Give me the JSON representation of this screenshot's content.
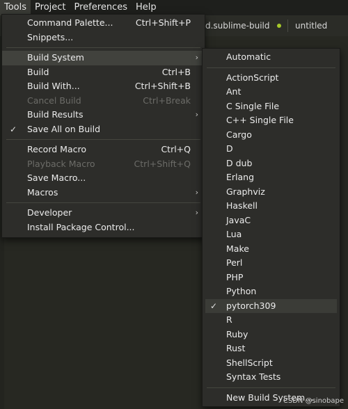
{
  "menubar": [
    "Tools",
    "Project",
    "Preferences",
    "Help"
  ],
  "tabs": {
    "file": "d.sublime-build",
    "untitled": "untitled"
  },
  "tools_menu": {
    "group1": [
      {
        "label": "Command Palette...",
        "shortcut": "Ctrl+Shift+P"
      },
      {
        "label": "Snippets...",
        "shortcut": ""
      }
    ],
    "group2": [
      {
        "label": "Build System",
        "shortcut": "",
        "submenu": true,
        "highlighted": true
      },
      {
        "label": "Build",
        "shortcut": "Ctrl+B"
      },
      {
        "label": "Build With...",
        "shortcut": "Ctrl+Shift+B"
      },
      {
        "label": "Cancel Build",
        "shortcut": "Ctrl+Break",
        "disabled": true
      },
      {
        "label": "Build Results",
        "shortcut": "",
        "submenu": true
      },
      {
        "label": "Save All on Build",
        "shortcut": "",
        "checked": true
      }
    ],
    "group3": [
      {
        "label": "Record Macro",
        "shortcut": "Ctrl+Q"
      },
      {
        "label": "Playback Macro",
        "shortcut": "Ctrl+Shift+Q",
        "disabled": true
      },
      {
        "label": "Save Macro...",
        "shortcut": ""
      },
      {
        "label": "Macros",
        "shortcut": "",
        "submenu": true
      }
    ],
    "group4": [
      {
        "label": "Developer",
        "shortcut": "",
        "submenu": true
      },
      {
        "label": "Install Package Control...",
        "shortcut": ""
      }
    ]
  },
  "build_system_menu": {
    "group1": [
      {
        "label": "Automatic"
      }
    ],
    "group2": [
      {
        "label": "ActionScript"
      },
      {
        "label": "Ant"
      },
      {
        "label": "C Single File"
      },
      {
        "label": "C++ Single File"
      },
      {
        "label": "Cargo"
      },
      {
        "label": "D"
      },
      {
        "label": "D dub"
      },
      {
        "label": "Erlang"
      },
      {
        "label": "Graphviz"
      },
      {
        "label": "Haskell"
      },
      {
        "label": "JavaC"
      },
      {
        "label": "Lua"
      },
      {
        "label": "Make"
      },
      {
        "label": "Perl"
      },
      {
        "label": "PHP"
      },
      {
        "label": "Python"
      },
      {
        "label": "pytorch309",
        "checked": true
      },
      {
        "label": "R"
      },
      {
        "label": "Ruby"
      },
      {
        "label": "Rust"
      },
      {
        "label": "ShellScript"
      },
      {
        "label": "Syntax Tests"
      }
    ],
    "group3": [
      {
        "label": "New Build System..."
      }
    ]
  },
  "symbols": {
    "check": "✓",
    "arrow": "›"
  },
  "watermark": "CSDN @sinobape",
  "colors": {
    "background": "#272822",
    "menu_bg": "#2d2d2a",
    "highlight": "#41423d",
    "dirty_dot": "#a6c92a"
  }
}
